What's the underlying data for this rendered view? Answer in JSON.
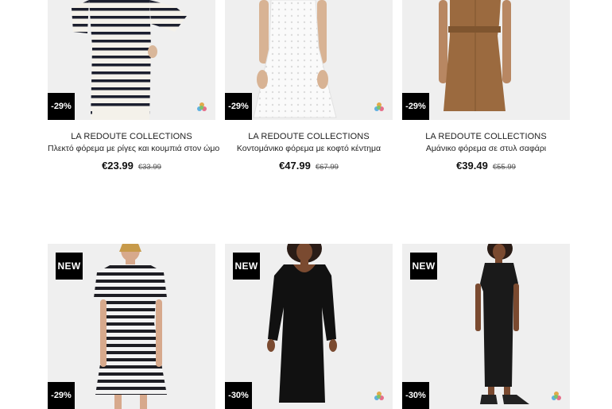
{
  "products": [
    {
      "brand": "LA REDOUTE COLLECTIONS",
      "title": "Πλεκτό φόρεμα με ρίγες και κουμπιά στον ώμο",
      "price": "€23.99",
      "old_price": "€33.99",
      "discount": "-29%",
      "has_swatch": true,
      "dress_color": "#f4f1ea",
      "stripe_color": "#1c1f2e"
    },
    {
      "brand": "LA REDOUTE COLLECTIONS",
      "title": "Κοντομάνικο φόρεμα με κοφτό κέντημα",
      "price": "€47.99",
      "old_price": "€67.99",
      "discount": "-29%",
      "has_swatch": true,
      "dress_color": "#fafafa"
    },
    {
      "brand": "LA REDOUTE COLLECTIONS",
      "title": "Αμάνικο φόρεμα σε στυλ σαφάρι",
      "price": "€39.49",
      "old_price": "€55.99",
      "discount": "-29%",
      "has_swatch": false,
      "dress_color": "#9b6a3f"
    },
    {
      "badge": "NEW",
      "discount": "-29%",
      "has_swatch": false,
      "dress_color": "#f3f3f3",
      "stripe_color": "#1e1e24"
    },
    {
      "badge": "NEW",
      "discount": "-30%",
      "has_swatch": true,
      "dress_color": "#111111"
    },
    {
      "badge": "NEW",
      "discount": "-30%",
      "has_swatch": true,
      "dress_color": "#1a1a1a"
    }
  ]
}
